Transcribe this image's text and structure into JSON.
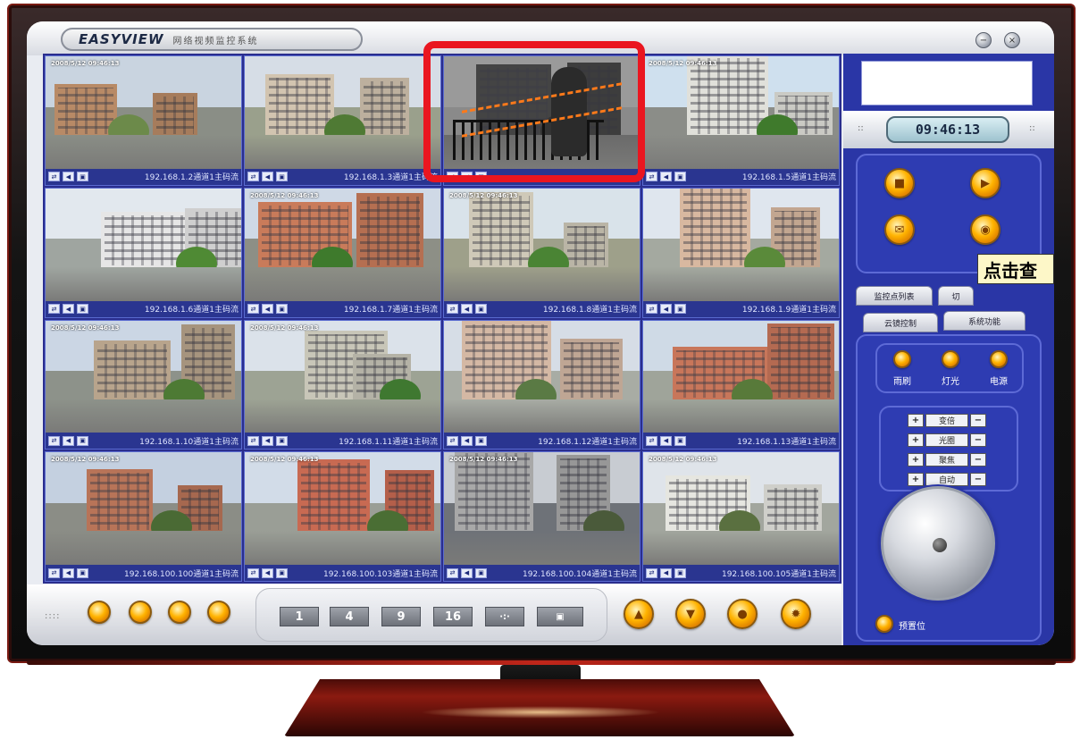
{
  "app": {
    "brand": "EASYVIEW",
    "subtitle": "网络视频监控系统",
    "window_buttons": [
      "minimize",
      "close"
    ]
  },
  "grid": {
    "cells": [
      {
        "timestamp": "2008/5/12 09:46:13",
        "label": "192.168.1.2通道1主码流"
      },
      {
        "timestamp": "",
        "label": "192.168.1.3通道1主码流"
      },
      {
        "timestamp": "",
        "label": ""
      },
      {
        "timestamp": "2008/5/12 09:46:13",
        "label": "192.168.1.5通道1主码流"
      },
      {
        "timestamp": "",
        "label": "192.168.1.6通道1主码流"
      },
      {
        "timestamp": "2008/5/12 09:46:13",
        "label": "192.168.1.7通道1主码流"
      },
      {
        "timestamp": "2008/5/12 09:46:13",
        "label": "192.168.1.8通道1主码流"
      },
      {
        "timestamp": "",
        "label": "192.168.1.9通道1主码流"
      },
      {
        "timestamp": "2008/5/12 09:46:13",
        "label": "192.168.1.10通道1主码流"
      },
      {
        "timestamp": "2008/5/12 09:46:13",
        "label": "192.168.1.11通道1主码流"
      },
      {
        "timestamp": "",
        "label": "192.168.1.12通道1主码流"
      },
      {
        "timestamp": "",
        "label": "192.168.1.13通道1主码流"
      },
      {
        "timestamp": "2008/5/12 09:46:13",
        "label": "192.168.100.100通道1主码流"
      },
      {
        "timestamp": "2008/5/12 09:46:13",
        "label": "192.168.100.103通道1主码流"
      },
      {
        "timestamp": "2008/5/12 09:46:13",
        "label": "192.168.100.104通道1主码流"
      },
      {
        "timestamp": "2008/5/12 09:46:13",
        "label": "192.168.100.105通道1主码流"
      }
    ],
    "alert_cell": 2
  },
  "toolbar": {
    "layouts": [
      "1",
      "4",
      "9",
      "16",
      "·:·"
    ]
  },
  "panel": {
    "clock": "09:46:13",
    "tabs": {
      "monitor_list": "监控点列表",
      "switch": "切",
      "ptz": "云镜控制",
      "system": "系统功能"
    },
    "tooltip": "点击查",
    "aux": [
      "雨刷",
      "灯光",
      "电源"
    ],
    "zoom": [
      "变倍",
      "光圈",
      "聚焦",
      "自动"
    ],
    "preset": "预置位"
  },
  "colors": {
    "panel_blue": "#2a36a6",
    "alert_red": "#ea1620",
    "button_orange": "#ffb300"
  }
}
